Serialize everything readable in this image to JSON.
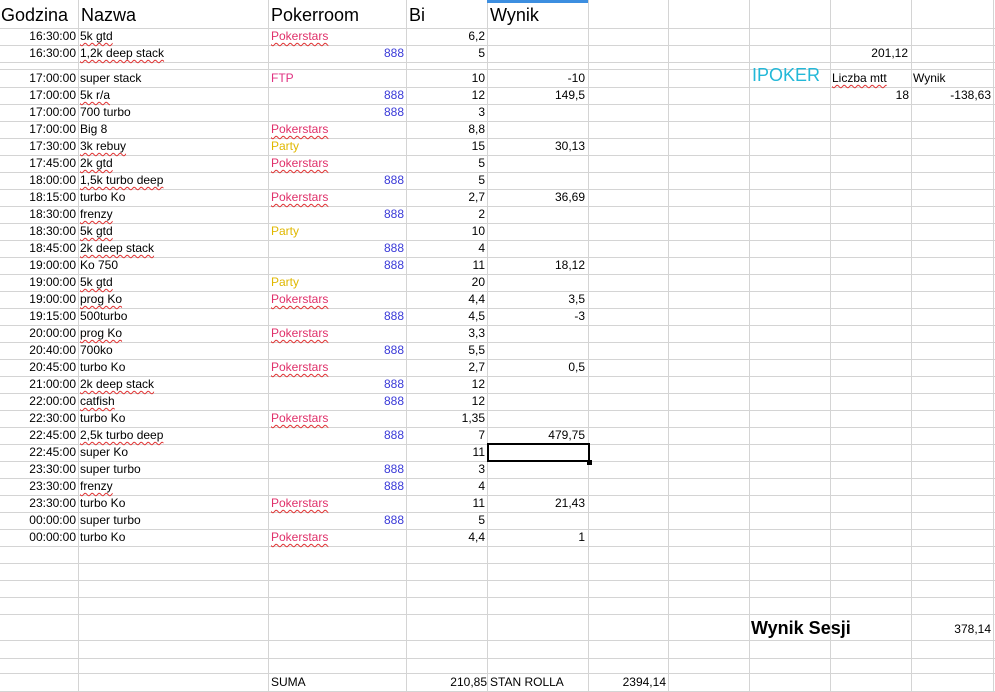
{
  "headers": {
    "time": "Godzina",
    "name": "Nazwa",
    "room": "Pokerroom",
    "bi": "Bi",
    "result": "Wynik"
  },
  "colors": {
    "Pokerstars": "#e0306a",
    "888": "#3a3ad8",
    "Party": "#e0b800",
    "FTP": "#e03080",
    "ipoker": "#22b8d8"
  },
  "rows": [
    {
      "time": "16:30:00",
      "name": "5k gtd",
      "room": "Pokerstars",
      "bi": "6,2",
      "result": ""
    },
    {
      "time": "16:30:00",
      "name": "1,2k deep stack",
      "room": "888",
      "bi": "5",
      "result": ""
    },
    {
      "time": "17:00:00",
      "name": "super stack",
      "room": "FTP",
      "bi": "10",
      "result": "-10"
    },
    {
      "time": "17:00:00",
      "name": "5k r/a",
      "room": "888",
      "bi": "12",
      "result": "149,5"
    },
    {
      "time": "17:00:00",
      "name": "700 turbo",
      "room": "888",
      "bi": "3",
      "result": ""
    },
    {
      "time": "17:00:00",
      "name": "Big 8",
      "room": "Pokerstars",
      "bi": "8,8",
      "result": ""
    },
    {
      "time": "17:30:00",
      "name": "3k rebuy",
      "room": "Party",
      "bi": "15",
      "result": "30,13"
    },
    {
      "time": "17:45:00",
      "name": "2k gtd",
      "room": "Pokerstars",
      "bi": "5",
      "result": ""
    },
    {
      "time": "18:00:00",
      "name": "1,5k turbo deep",
      "room": "888",
      "bi": "5",
      "result": ""
    },
    {
      "time": "18:15:00",
      "name": "turbo Ko",
      "room": "Pokerstars",
      "bi": "2,7",
      "result": "36,69"
    },
    {
      "time": "18:30:00",
      "name": "frenzy",
      "room": "888",
      "bi": "2",
      "result": ""
    },
    {
      "time": "18:30:00",
      "name": "5k gtd",
      "room": "Party",
      "bi": "10",
      "result": ""
    },
    {
      "time": "18:45:00",
      "name": "2k deep stack",
      "room": "888",
      "bi": "4",
      "result": ""
    },
    {
      "time": "19:00:00",
      "name": "Ko 750",
      "room": "888",
      "bi": "11",
      "result": "18,12"
    },
    {
      "time": "19:00:00",
      "name": "5k gtd",
      "room": "Party",
      "bi": "20",
      "result": ""
    },
    {
      "time": "19:00:00",
      "name": "prog Ko",
      "room": "Pokerstars",
      "bi": "4,4",
      "result": "3,5"
    },
    {
      "time": "19:15:00",
      "name": "500turbo",
      "room": "888",
      "bi": "4,5",
      "result": "-3"
    },
    {
      "time": "20:00:00",
      "name": "prog Ko",
      "room": "Pokerstars",
      "bi": "3,3",
      "result": ""
    },
    {
      "time": "20:40:00",
      "name": "700ko",
      "room": "888",
      "bi": "5,5",
      "result": ""
    },
    {
      "time": "20:45:00",
      "name": "turbo Ko",
      "room": "Pokerstars",
      "bi": "2,7",
      "result": "0,5"
    },
    {
      "time": "21:00:00",
      "name": "2k deep stack",
      "room": "888",
      "bi": "12",
      "result": ""
    },
    {
      "time": "22:00:00",
      "name": "catfish",
      "room": "888",
      "bi": "12",
      "result": ""
    },
    {
      "time": "22:30:00",
      "name": "turbo Ko",
      "room": "Pokerstars",
      "bi": "1,35",
      "result": ""
    },
    {
      "time": "22:45:00",
      "name": "2,5k turbo deep",
      "room": "888",
      "bi": "7",
      "result": "479,75"
    },
    {
      "time": "22:45:00",
      "name": "super Ko",
      "room": "",
      "bi": "11",
      "result": ""
    },
    {
      "time": "23:30:00",
      "name": "super turbo",
      "room": "888",
      "bi": "3",
      "result": ""
    },
    {
      "time": "23:30:00",
      "name": "frenzy",
      "room": "888",
      "bi": "4",
      "result": ""
    },
    {
      "time": "23:30:00",
      "name": "turbo Ko",
      "room": "Pokerstars",
      "bi": "11",
      "result": "21,43"
    },
    {
      "time": "00:00:00",
      "name": "super turbo",
      "room": "888",
      "bi": "5",
      "result": ""
    },
    {
      "time": "00:00:00",
      "name": "turbo Ko",
      "room": "Pokerstars",
      "bi": "4,4",
      "result": "1"
    }
  ],
  "side": {
    "value_top": "201,12",
    "ipoker": "IPOKER",
    "liczba_label": "Liczba mtt",
    "wynik_label": "Wynik",
    "liczba_value": "18",
    "wynik_value": "-138,63",
    "session_label": "Wynik Sesji",
    "session_value": "378,14"
  },
  "footer": {
    "suma_label": "SUMA",
    "suma_value": "210,85",
    "stan_label": "STAN ROLLA",
    "stan_value": "2394,14"
  }
}
